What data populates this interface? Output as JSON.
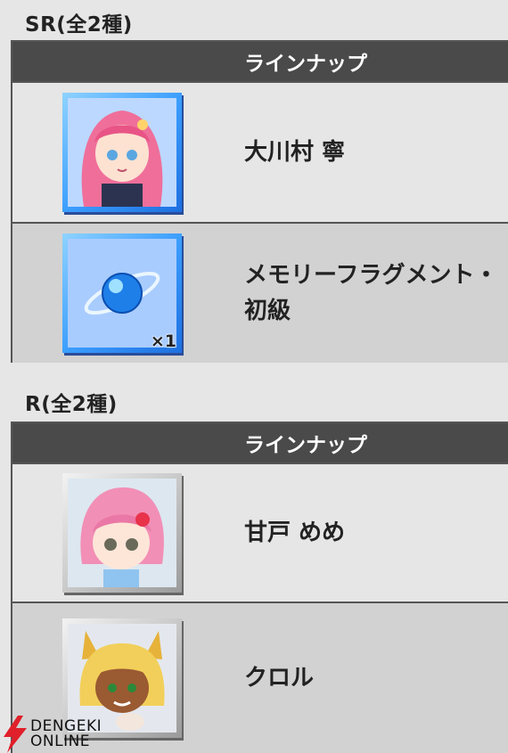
{
  "sr_section": {
    "title": "SR(全2種)",
    "header": "ラインナップ",
    "rows": [
      {
        "name": "大川村 寧",
        "icon": "pink-haired-girl-avatar-icon"
      },
      {
        "name": "メモリーフラグメント・初級",
        "icon": "blue-orb-icon",
        "qty": "×1"
      }
    ]
  },
  "r_section": {
    "title": "R(全2種)",
    "header": "ラインナップ",
    "rows": [
      {
        "name": "甘戸 めめ",
        "icon": "pink-haired-chibi-avatar-icon"
      },
      {
        "name": "クロル",
        "icon": "cat-eared-chibi-avatar-icon"
      }
    ]
  },
  "watermark": {
    "line1": "DENGEKI",
    "line2": "ONLINE"
  },
  "colors": {
    "header_bg": "#4a4a4a",
    "sr_frame": "#3c9fff",
    "r_frame": "#c9c9c9",
    "accent": "#e0202a"
  }
}
